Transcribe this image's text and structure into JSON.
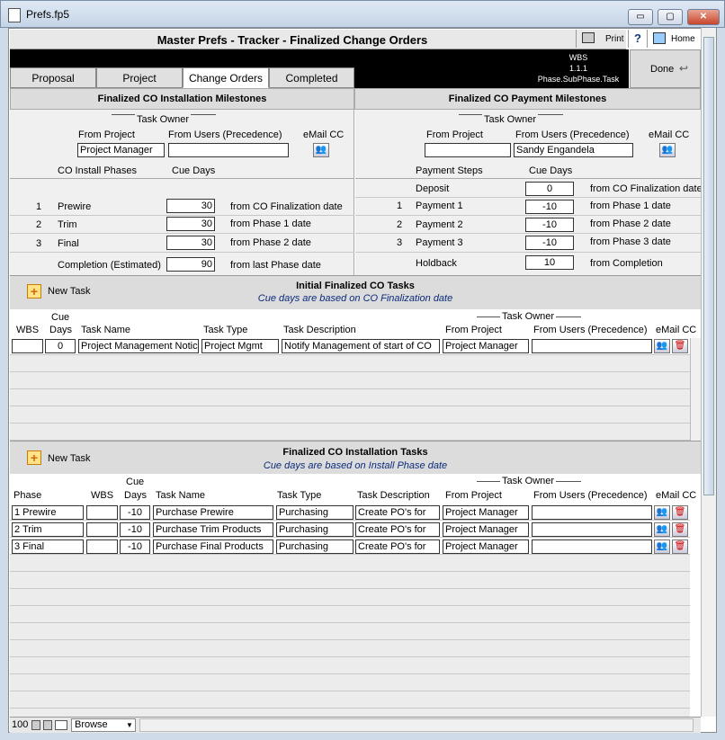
{
  "window": {
    "title": "Prefs.fp5",
    "btn_min": "▭",
    "btn_max": "▢",
    "btn_close": "✕"
  },
  "header": {
    "title": "Master Prefs - Tracker - Finalized Change Orders",
    "print": "Print",
    "help": "?",
    "home": "Home"
  },
  "wbs_legend": {
    "line1": "WBS",
    "line2": "1.1.1",
    "line3": "Phase.SubPhase.Task"
  },
  "done": "Done",
  "tabs": [
    "Proposal",
    "Project",
    "Change Orders",
    "Completed"
  ],
  "install_milestones": {
    "title": "Finalized CO Installation Milestones",
    "task_owner": "Task Owner",
    "from_project_label": "From Project",
    "from_users_label": "From Users (Precedence)",
    "email_cc": "eMail CC",
    "from_project_value": "Project Manager",
    "from_users_value": "",
    "phases_header": "CO Install Phases",
    "cue_days_header": "Cue Days",
    "rows": [
      {
        "num": "1",
        "name": "Prewire",
        "cue": "30",
        "from": "from CO Finalization date"
      },
      {
        "num": "2",
        "name": "Trim",
        "cue": "30",
        "from": "from Phase 1 date"
      },
      {
        "num": "3",
        "name": "Final",
        "cue": "30",
        "from": "from Phase 2 date"
      }
    ],
    "completion": {
      "name": "Completion (Estimated)",
      "cue": "90",
      "from": "from last Phase date"
    }
  },
  "payment_milestones": {
    "title": "Finalized CO Payment Milestones",
    "task_owner": "Task Owner",
    "from_project_label": "From Project",
    "from_users_label": "From Users (Precedence)",
    "email_cc": "eMail CC",
    "from_project_value": "",
    "from_users_value": "Sandy Engandela",
    "steps_header": "Payment Steps",
    "cue_days_header": "Cue Days",
    "deposit": {
      "name": "Deposit",
      "cue": "0",
      "from": "from CO Finalization date"
    },
    "rows": [
      {
        "num": "1",
        "name": "Payment 1",
        "cue": "-10",
        "from": "from Phase 1 date"
      },
      {
        "num": "2",
        "name": "Payment 2",
        "cue": "-10",
        "from": "from Phase 2 date"
      },
      {
        "num": "3",
        "name": "Payment 3",
        "cue": "-10",
        "from": "from Phase 3 date"
      }
    ],
    "holdback": {
      "name": "Holdback",
      "cue": "10",
      "from": "from Completion"
    }
  },
  "initial_tasks": {
    "new_task": "New Task",
    "title": "Initial Finalized CO Tasks",
    "subtitle": "Cue days are based on CO Finalization date",
    "col_wbs": "WBS",
    "col_cue1": "Cue",
    "col_cue2": "Days",
    "col_name": "Task Name",
    "col_type": "Task Type",
    "col_desc": "Task Description",
    "task_owner": "Task Owner",
    "col_from_project": "From Project",
    "col_from_users": "From Users (Precedence)",
    "col_email": "eMail CC",
    "rows": [
      {
        "wbs": "",
        "cue": "0",
        "name": "Project Management Notice",
        "type": "Project Mgmt",
        "desc": "Notify Management of start of CO",
        "from_project": "Project Manager",
        "from_users": ""
      }
    ]
  },
  "install_tasks": {
    "new_task": "New Task",
    "title": "Finalized CO Installation Tasks",
    "subtitle": "Cue days are based on Install Phase date",
    "col_phase": "Phase",
    "col_wbs": "WBS",
    "col_cue1": "Cue",
    "col_cue2": "Days",
    "col_name": "Task Name",
    "col_type": "Task Type",
    "col_desc": "Task Description",
    "task_owner": "Task Owner",
    "col_from_project": "From Project",
    "col_from_users": "From Users (Precedence)",
    "col_email": "eMail CC",
    "rows": [
      {
        "phase": "1 Prewire",
        "wbs": "",
        "cue": "-10",
        "name": "Purchase Prewire",
        "type": "Purchasing",
        "desc": "Create PO's for",
        "from_project": "Project Manager",
        "from_users": ""
      },
      {
        "phase": "2 Trim",
        "wbs": "",
        "cue": "-10",
        "name": "Purchase Trim Products",
        "type": "Purchasing",
        "desc": "Create PO's for",
        "from_project": "Project Manager",
        "from_users": ""
      },
      {
        "phase": "3 Final",
        "wbs": "",
        "cue": "-10",
        "name": "Purchase Final Products",
        "type": "Purchasing",
        "desc": "Create PO's for",
        "from_project": "Project Manager",
        "from_users": ""
      }
    ]
  },
  "statusbar": {
    "zoom": "100",
    "mode": "Browse"
  }
}
